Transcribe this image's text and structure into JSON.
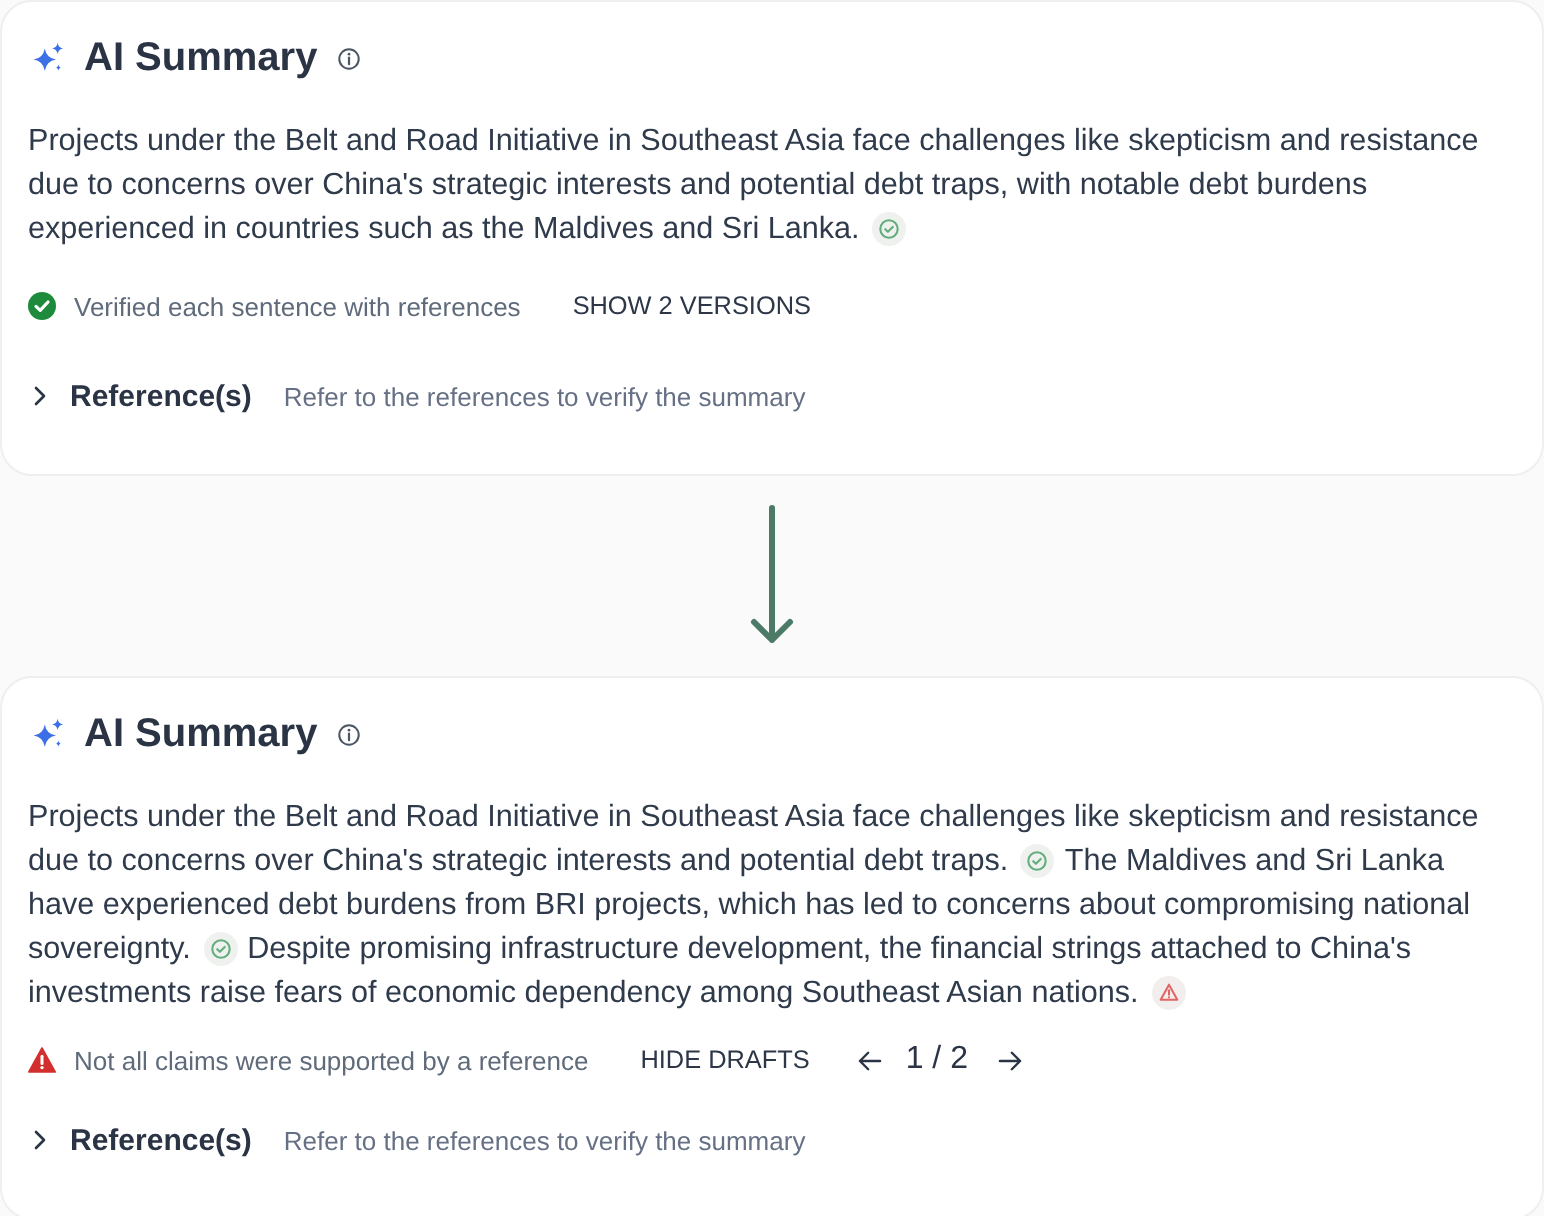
{
  "cards": [
    {
      "title": "AI Summary",
      "sentences": [
        {
          "lines": [
            "Projects under the Belt and Road Initiative in Southeast Asia face challenges like skepticism and resistance",
            "due to concerns over China's strategic interests and potential debt traps, with notable debt burdens",
            "experienced in countries such as the Maldives and Sri Lanka."
          ],
          "kind": "verified"
        }
      ],
      "status": {
        "kind": "verified",
        "text": "Verified each sentence with references"
      },
      "versions_button": "SHOW 2 VERSIONS",
      "references": {
        "label": "Reference(s)",
        "hint": "Refer to the references to verify the summary",
        "expanded": false
      }
    },
    {
      "title": "AI Summary",
      "sentences": [
        {
          "lines": [
            "Projects under the Belt and Road Initiative in Southeast Asia face challenges like skepticism and resistance",
            "due to concerns over China's strategic interests and potential debt traps."
          ],
          "kind": "verified"
        },
        {
          "lines": [
            "The Maldives and Sri Lanka",
            "have experienced debt burdens from BRI projects, which has led to concerns about compromising national",
            "sovereignty."
          ],
          "kind": "verified"
        },
        {
          "lines": [
            "Despite promising infrastructure development, the financial strings attached to China's",
            "investments raise fears of economic dependency among Southeast Asian nations."
          ],
          "kind": "unsupported"
        }
      ],
      "status": {
        "kind": "warning",
        "text": "Not all claims were supported by a reference"
      },
      "versions_button": "HIDE DRAFTS",
      "pager": {
        "text": "1 / 2"
      },
      "references": {
        "label": "Reference(s)",
        "hint": "Refer to the references to verify the summary",
        "expanded": false
      }
    }
  ]
}
